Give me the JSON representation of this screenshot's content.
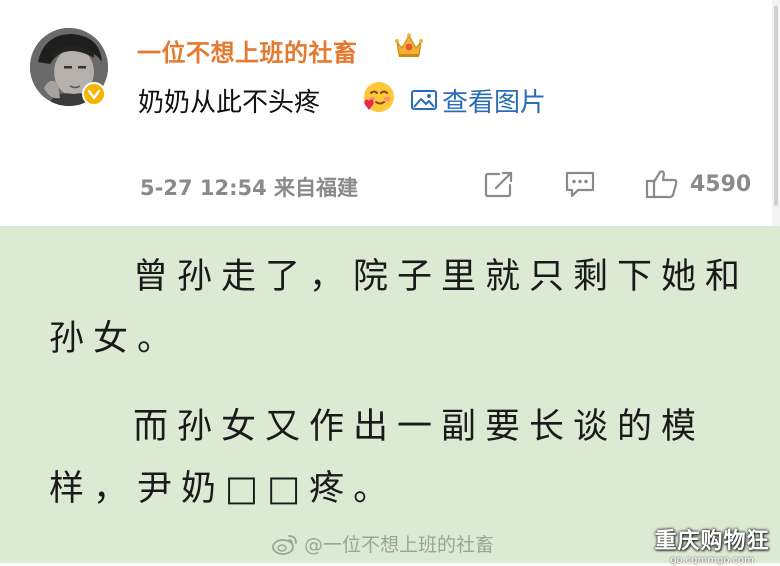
{
  "post": {
    "username": "一位不想上班的社畜",
    "text": "奶奶从此不头疼",
    "view_image_label": "查看图片",
    "timestamp_source": "5-27 12:54 来自福建",
    "like_count": "4590",
    "icons": {
      "badge": "verified-badge-icon",
      "crown": "crown-icon",
      "emoji": "smitten-face-emoji-icon",
      "image": "image-icon",
      "share": "share-icon",
      "comment": "comment-icon",
      "like": "thumbs-up-icon"
    },
    "colors": {
      "username": "#e57a2e",
      "link": "#2b6cb8",
      "meta": "#8a8a8a"
    }
  },
  "reader": {
    "background": "#dcead3",
    "paragraph_1": "曾孙走了，院子里就只剩下她和孙女。",
    "paragraph_2": "而孙女又作出一副要长谈的模样，尹奶□□疼。",
    "watermark": "@一位不想上班的社畜",
    "site_name": "重庆购物狂",
    "site_url": "go.cqmmgo.com"
  }
}
